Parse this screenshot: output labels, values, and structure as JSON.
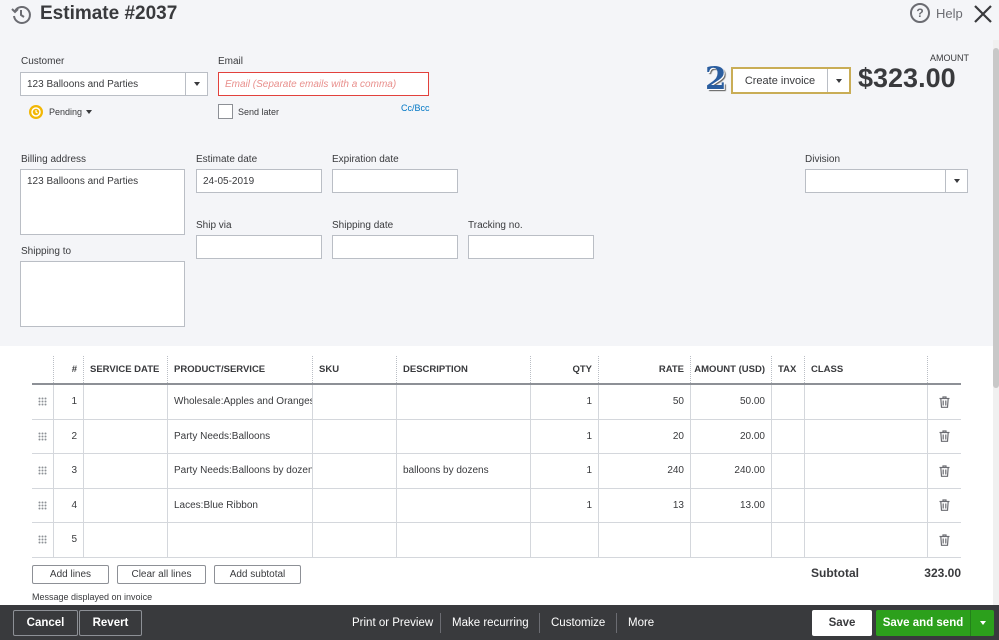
{
  "header": {
    "title": "Estimate #2037",
    "help_label": "Help"
  },
  "customer": {
    "label": "Customer",
    "value": "123 Balloons and Parties",
    "status": "Pending"
  },
  "email": {
    "label": "Email",
    "placeholder": "Email (Separate emails with a comma)",
    "send_later": "Send later",
    "ccbcc": "Cc/Bcc"
  },
  "annotation_number": "2",
  "create_invoice_label": "Create invoice",
  "amount": {
    "label": "AMOUNT",
    "value": "$323.00"
  },
  "billing": {
    "label": "Billing address",
    "value": "123 Balloons and Parties"
  },
  "shipping_to": {
    "label": "Shipping to",
    "value": ""
  },
  "estimate_date": {
    "label": "Estimate date",
    "value": "24-05-2019"
  },
  "expiration_date": {
    "label": "Expiration date",
    "value": ""
  },
  "division": {
    "label": "Division",
    "value": ""
  },
  "ship_via": {
    "label": "Ship via",
    "value": ""
  },
  "shipping_date": {
    "label": "Shipping date",
    "value": ""
  },
  "tracking_no": {
    "label": "Tracking no.",
    "value": ""
  },
  "table": {
    "headers": {
      "num": "#",
      "service_date": "SERVICE DATE",
      "product": "PRODUCT/SERVICE",
      "sku": "SKU",
      "description": "DESCRIPTION",
      "qty": "QTY",
      "rate": "RATE",
      "amount": "AMOUNT (USD)",
      "tax": "TAX",
      "class": "CLASS"
    },
    "rows": [
      {
        "num": "1",
        "service_date": "",
        "product": "Wholesale:Apples and Oranges",
        "sku": "",
        "description": "",
        "qty": "1",
        "rate": "50",
        "amount": "50.00",
        "tax": "",
        "class": ""
      },
      {
        "num": "2",
        "service_date": "",
        "product": "Party Needs:Balloons",
        "sku": "",
        "description": "",
        "qty": "1",
        "rate": "20",
        "amount": "20.00",
        "tax": "",
        "class": ""
      },
      {
        "num": "3",
        "service_date": "",
        "product": "Party Needs:Balloons by dozens",
        "sku": "",
        "description": "balloons by dozens",
        "qty": "1",
        "rate": "240",
        "amount": "240.00",
        "tax": "",
        "class": ""
      },
      {
        "num": "4",
        "service_date": "",
        "product": "Laces:Blue Ribbon",
        "sku": "",
        "description": "",
        "qty": "1",
        "rate": "13",
        "amount": "13.00",
        "tax": "",
        "class": ""
      },
      {
        "num": "5",
        "service_date": "",
        "product": "",
        "sku": "",
        "description": "",
        "qty": "",
        "rate": "",
        "amount": "",
        "tax": "",
        "class": ""
      }
    ]
  },
  "buttons": {
    "add_lines": "Add lines",
    "clear_all_lines": "Clear all lines",
    "add_subtotal": "Add subtotal"
  },
  "subtotal": {
    "label": "Subtotal",
    "value": "323.00"
  },
  "message_label": "Message displayed on invoice",
  "footer": {
    "cancel": "Cancel",
    "revert": "Revert",
    "print_preview": "Print or Preview",
    "make_recurring": "Make recurring",
    "customize": "Customize",
    "more": "More",
    "save": "Save",
    "save_and_send": "Save and send"
  },
  "colors": {
    "accent_green": "#2ca01c",
    "footer_bg": "#393a3d",
    "highlight_gold": "#c9ad56",
    "link_blue": "#0077c5",
    "error_red": "#e2413c"
  }
}
